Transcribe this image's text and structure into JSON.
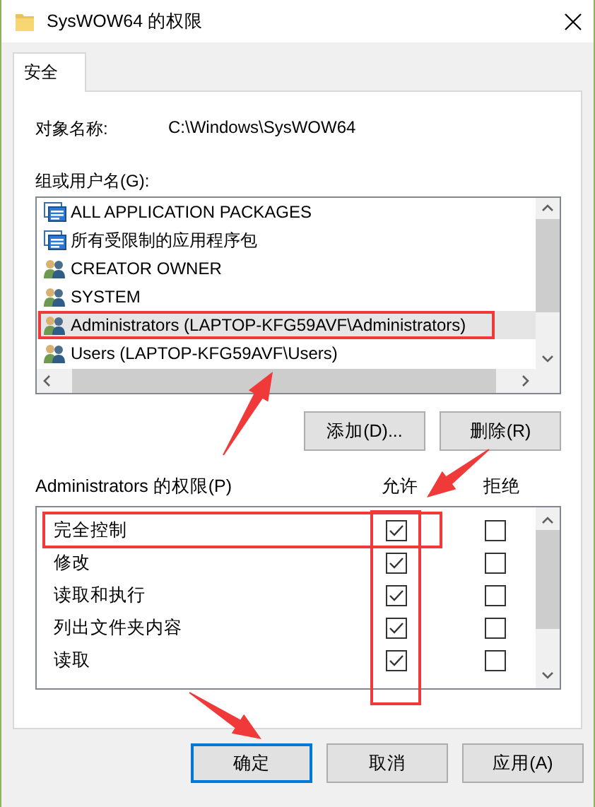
{
  "window": {
    "title": "SysWOW64 的权限"
  },
  "tabs": [
    {
      "label": "安全",
      "selected": true
    }
  ],
  "object_name": {
    "label": "对象名称:",
    "value": "C:\\Windows\\SysWOW64"
  },
  "groups": {
    "label": "组或用户名(G):",
    "items": [
      {
        "name": "ALL APPLICATION PACKAGES",
        "kind": "package",
        "selected": false,
        "highlighted": false
      },
      {
        "name": "所有受限制的应用程序包",
        "kind": "package",
        "selected": false,
        "highlighted": false
      },
      {
        "name": "CREATOR OWNER",
        "kind": "group",
        "selected": false,
        "highlighted": false
      },
      {
        "name": "SYSTEM",
        "kind": "group",
        "selected": false,
        "highlighted": false
      },
      {
        "name": "Administrators (LAPTOP-KFG59AVF\\Administrators)",
        "kind": "group",
        "selected": true,
        "highlighted": true
      },
      {
        "name": "Users (LAPTOP-KFG59AVF\\Users)",
        "kind": "group",
        "selected": false,
        "highlighted": false
      }
    ]
  },
  "group_buttons": [
    "添加(D)...",
    "删除(R)"
  ],
  "permissions": {
    "label": "Administrators 的权限(P)",
    "allow_header": "允许",
    "deny_header": "拒绝",
    "allow_column_highlighted": true,
    "rows": [
      {
        "name": "完全控制",
        "allow": true,
        "deny": false,
        "highlighted": true
      },
      {
        "name": "修改",
        "allow": true,
        "deny": false,
        "highlighted": false
      },
      {
        "name": "读取和执行",
        "allow": true,
        "deny": false,
        "highlighted": false
      },
      {
        "name": "列出文件夹内容",
        "allow": true,
        "deny": false,
        "highlighted": false
      },
      {
        "name": "读取",
        "allow": true,
        "deny": false,
        "highlighted": false
      }
    ]
  },
  "buttons": [
    {
      "label": "确定",
      "default": true
    },
    {
      "label": "取消",
      "default": false
    },
    {
      "label": "应用(A)",
      "default": false
    }
  ]
}
